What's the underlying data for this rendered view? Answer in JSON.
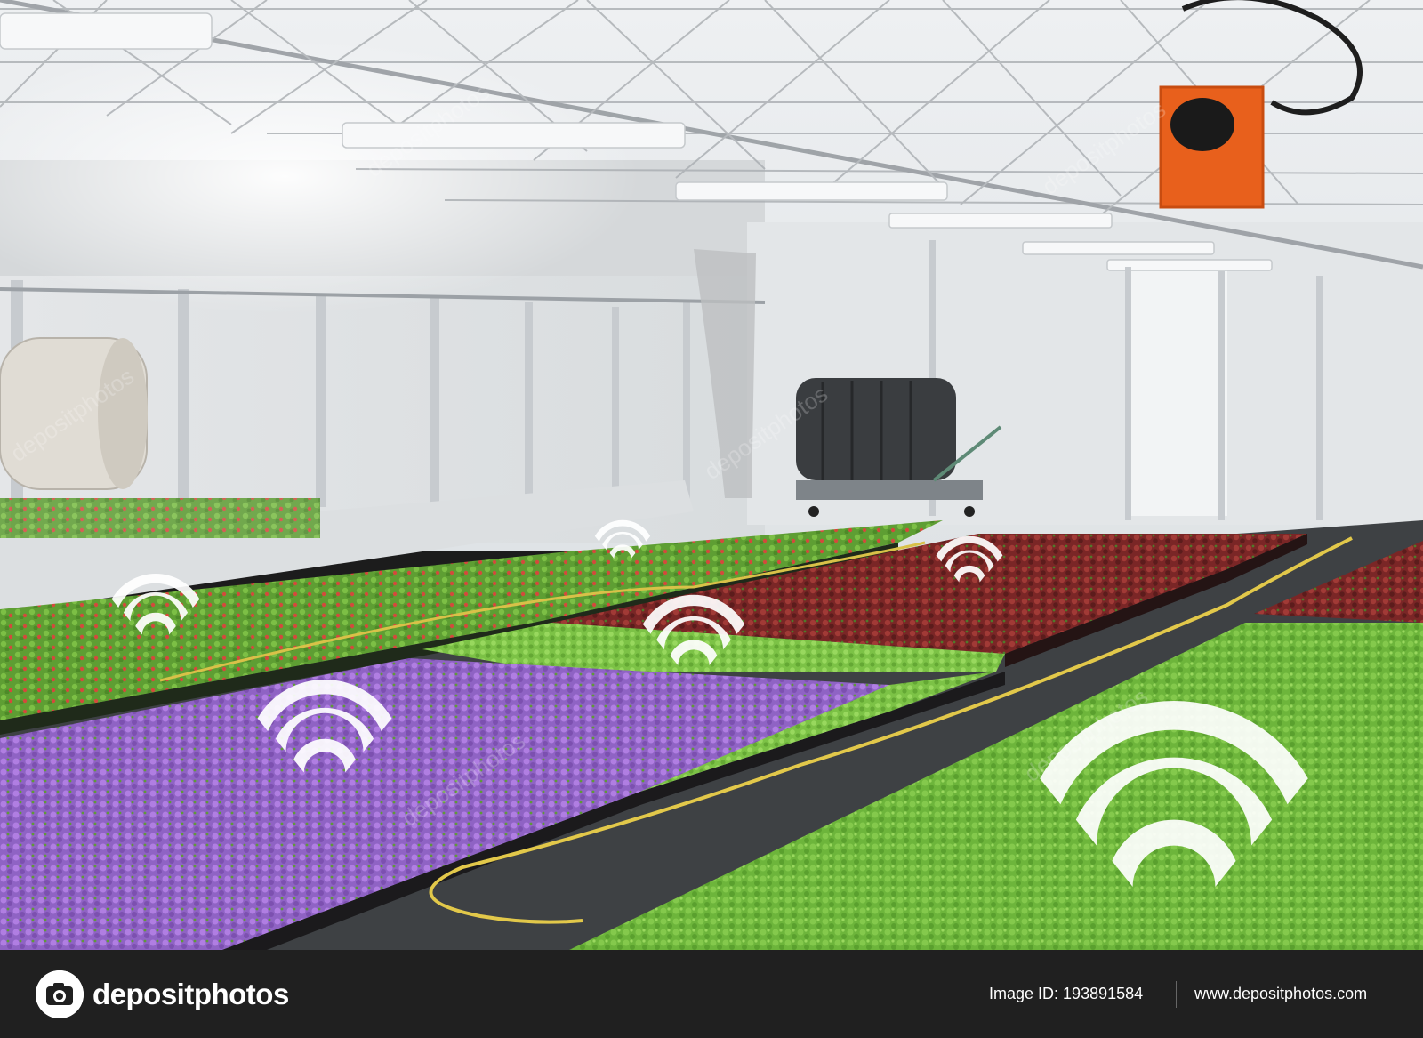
{
  "scene": {
    "description_icons": [
      "wifi-icon",
      "wifi-icon",
      "wifi-icon",
      "wifi-icon",
      "wifi-icon",
      "wifi-icon"
    ],
    "watermark_text": "depositphotos"
  },
  "footer": {
    "brand": "depositphotos",
    "image_id_label": "Image ID:",
    "image_id_value": "193891584",
    "site": "www.depositphotos.com"
  },
  "colors": {
    "footer_bg": "#202020",
    "fan_orange": "#e8601c",
    "hose_yellow": "#e2c84a",
    "purple_flowers": "#a070d0",
    "green_plants": "#6fb43a",
    "red_plants": "#8a2a2a"
  }
}
